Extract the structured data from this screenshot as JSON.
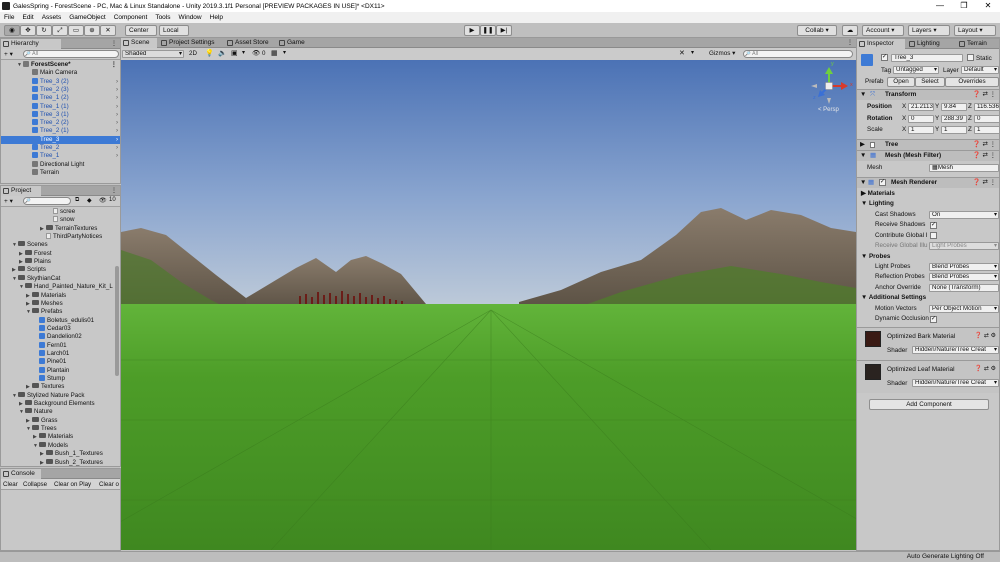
{
  "window": {
    "title": "GalesSpring - ForestScene - PC, Mac & Linux Standalone - Unity 2019.3.1f1 Personal [PREVIEW PACKAGES IN USE]* <DX11>",
    "controls": [
      "—",
      "❐",
      "✕"
    ]
  },
  "menu": [
    "File",
    "Edit",
    "Assets",
    "GameObject",
    "Component",
    "Tools",
    "Window",
    "Help"
  ],
  "toolbar": {
    "pivot": "Center",
    "space": "Local",
    "collab": "Collab ▾",
    "account": "Account",
    "layers": "Layers",
    "layout": "Layout"
  },
  "hierarchy": {
    "tab": "Hierarchy",
    "add": "+ ▾",
    "search_placeholder": "All",
    "scene": "ForestScene*",
    "items": [
      {
        "label": "Main Camera",
        "kind": "grey"
      },
      {
        "label": "Tree_3 (2)",
        "kind": "blue"
      },
      {
        "label": "Tree_2 (3)",
        "kind": "blue"
      },
      {
        "label": "Tree_1 (2)",
        "kind": "blue"
      },
      {
        "label": "Tree_1 (1)",
        "kind": "blue"
      },
      {
        "label": "Tree_3 (1)",
        "kind": "blue"
      },
      {
        "label": "Tree_2 (2)",
        "kind": "blue"
      },
      {
        "label": "Tree_2 (1)",
        "kind": "blue"
      },
      {
        "label": "Tree_3",
        "kind": "blue",
        "selected": true
      },
      {
        "label": "Tree_2",
        "kind": "blue"
      },
      {
        "label": "Tree_1",
        "kind": "blue"
      },
      {
        "label": "Directional Light",
        "kind": "grey"
      },
      {
        "label": "Terrain",
        "kind": "grey"
      }
    ]
  },
  "project": {
    "tab": "Project",
    "add": "+ ▾",
    "count": "10",
    "items": [
      {
        "label": "scree",
        "indent": 6,
        "icon": "file"
      },
      {
        "label": "snow",
        "indent": 6,
        "icon": "file"
      },
      {
        "label": "TerrainTextures",
        "indent": 5,
        "icon": "folder",
        "arrow": "▶"
      },
      {
        "label": "ThirdPartyNotices",
        "indent": 5,
        "icon": "file"
      },
      {
        "label": "Scenes",
        "indent": 1,
        "icon": "folder",
        "arrow": "▼"
      },
      {
        "label": "Forest",
        "indent": 2,
        "icon": "folder",
        "arrow": "▶"
      },
      {
        "label": "Plains",
        "indent": 2,
        "icon": "folder",
        "arrow": "▶"
      },
      {
        "label": "Scripts",
        "indent": 1,
        "icon": "folder",
        "arrow": "▶"
      },
      {
        "label": "SkythianCat",
        "indent": 1,
        "icon": "folder",
        "arrow": "▼"
      },
      {
        "label": "Hand_Painted_Nature_Kit_L",
        "indent": 2,
        "icon": "folder",
        "arrow": "▼"
      },
      {
        "label": "Materials",
        "indent": 3,
        "icon": "folder",
        "arrow": "▶"
      },
      {
        "label": "Meshes",
        "indent": 3,
        "icon": "folder",
        "arrow": "▶"
      },
      {
        "label": "Prefabs",
        "indent": 3,
        "icon": "folder",
        "arrow": "▼"
      },
      {
        "label": "Boletus_edulis01",
        "indent": 4,
        "icon": "blue"
      },
      {
        "label": "Cedar03",
        "indent": 4,
        "icon": "blue"
      },
      {
        "label": "Dandelion02",
        "indent": 4,
        "icon": "blue"
      },
      {
        "label": "Fern01",
        "indent": 4,
        "icon": "blue"
      },
      {
        "label": "Larch01",
        "indent": 4,
        "icon": "blue"
      },
      {
        "label": "Pine01",
        "indent": 4,
        "icon": "blue"
      },
      {
        "label": "Plantain",
        "indent": 4,
        "icon": "blue"
      },
      {
        "label": "Stump",
        "indent": 4,
        "icon": "blue"
      },
      {
        "label": "Textures",
        "indent": 3,
        "icon": "folder",
        "arrow": "▶"
      },
      {
        "label": "Stylized Nature Pack",
        "indent": 1,
        "icon": "folder",
        "arrow": "▼"
      },
      {
        "label": "Background Elements",
        "indent": 2,
        "icon": "folder",
        "arrow": "▶"
      },
      {
        "label": "Nature",
        "indent": 2,
        "icon": "folder",
        "arrow": "▼"
      },
      {
        "label": "Grass",
        "indent": 3,
        "icon": "folder",
        "arrow": "▶"
      },
      {
        "label": "Trees",
        "indent": 3,
        "icon": "folder",
        "arrow": "▼"
      },
      {
        "label": "Materials",
        "indent": 4,
        "icon": "folder",
        "arrow": "▶"
      },
      {
        "label": "Models",
        "indent": 4,
        "icon": "folder",
        "arrow": "▼"
      },
      {
        "label": "Bush_1_Textures",
        "indent": 5,
        "icon": "folder",
        "arrow": "▶"
      },
      {
        "label": "Bush_2_Textures",
        "indent": 5,
        "icon": "folder",
        "arrow": "▶"
      }
    ]
  },
  "console": {
    "tab": "Console",
    "buttons": [
      "Clear",
      "Collapse",
      "Clear on Play",
      "Clear o"
    ]
  },
  "scene_view": {
    "tabs": [
      "Scene",
      "Project Settings",
      "Asset Store",
      "Game"
    ],
    "shading": "Shaded",
    "mode_2d": "2D",
    "fx_count": "0",
    "gizmos": "Gizmos ▾",
    "search_placeholder": "All",
    "persp": "< Persp",
    "axes": [
      "y",
      "x",
      "z"
    ]
  },
  "inspector": {
    "tabs": [
      "Inspector",
      "Lighting",
      "Terrain"
    ],
    "object_name": "Tree_3",
    "static_label": "Static",
    "tag_label": "Tag",
    "tag_value": "Untagged",
    "layer_label": "Layer",
    "layer_value": "Default",
    "prefab_label": "Prefab",
    "prefab_open": "Open",
    "prefab_select": "Select",
    "prefab_overrides": "Overrides",
    "transform": {
      "title": "Transform",
      "position": {
        "label": "Position",
        "x": "21.2113",
        "y": "9.84",
        "z": "116.536"
      },
      "rotation": {
        "label": "Rotation",
        "x": "0",
        "y": "288.39",
        "z": "0"
      },
      "scale": {
        "label": "Scale",
        "x": "1",
        "y": "1",
        "z": "1"
      }
    },
    "tree_component": "Tree",
    "mesh_filter": {
      "title": "Mesh (Mesh Filter)",
      "label": "Mesh",
      "value": "Mesh"
    },
    "mesh_renderer": {
      "title": "Mesh Renderer",
      "materials": "Materials",
      "lighting": "Lighting",
      "cast_shadows_label": "Cast Shadows",
      "cast_shadows": "On",
      "receive_shadows": "Receive Shadows",
      "contribute_gi": "Contribute Global I",
      "receive_gi_label": "Receive Global Illu",
      "receive_gi": "Light Probes",
      "probes": "Probes",
      "light_probes_label": "Light Probes",
      "light_probes": "Blend Probes",
      "reflection_probes_label": "Reflection Probes",
      "reflection_probes": "Blend Probes",
      "anchor_label": "Anchor Override",
      "anchor": "None (Transform)",
      "additional": "Additional Settings",
      "motion_label": "Motion Vectors",
      "motion": "Per Object Motion",
      "dynamic_occ": "Dynamic Occlusion"
    },
    "materials_list": [
      {
        "name": "Optimized Bark Material",
        "shader_label": "Shader",
        "shader": "Hidden/Nature/Tree Creat"
      },
      {
        "name": "Optimized Leaf Material",
        "shader_label": "Shader",
        "shader": "Hidden/Nature/Tree Creat"
      }
    ],
    "add_component": "Add Component"
  },
  "status": {
    "right": "Auto Generate Lighting Off"
  }
}
